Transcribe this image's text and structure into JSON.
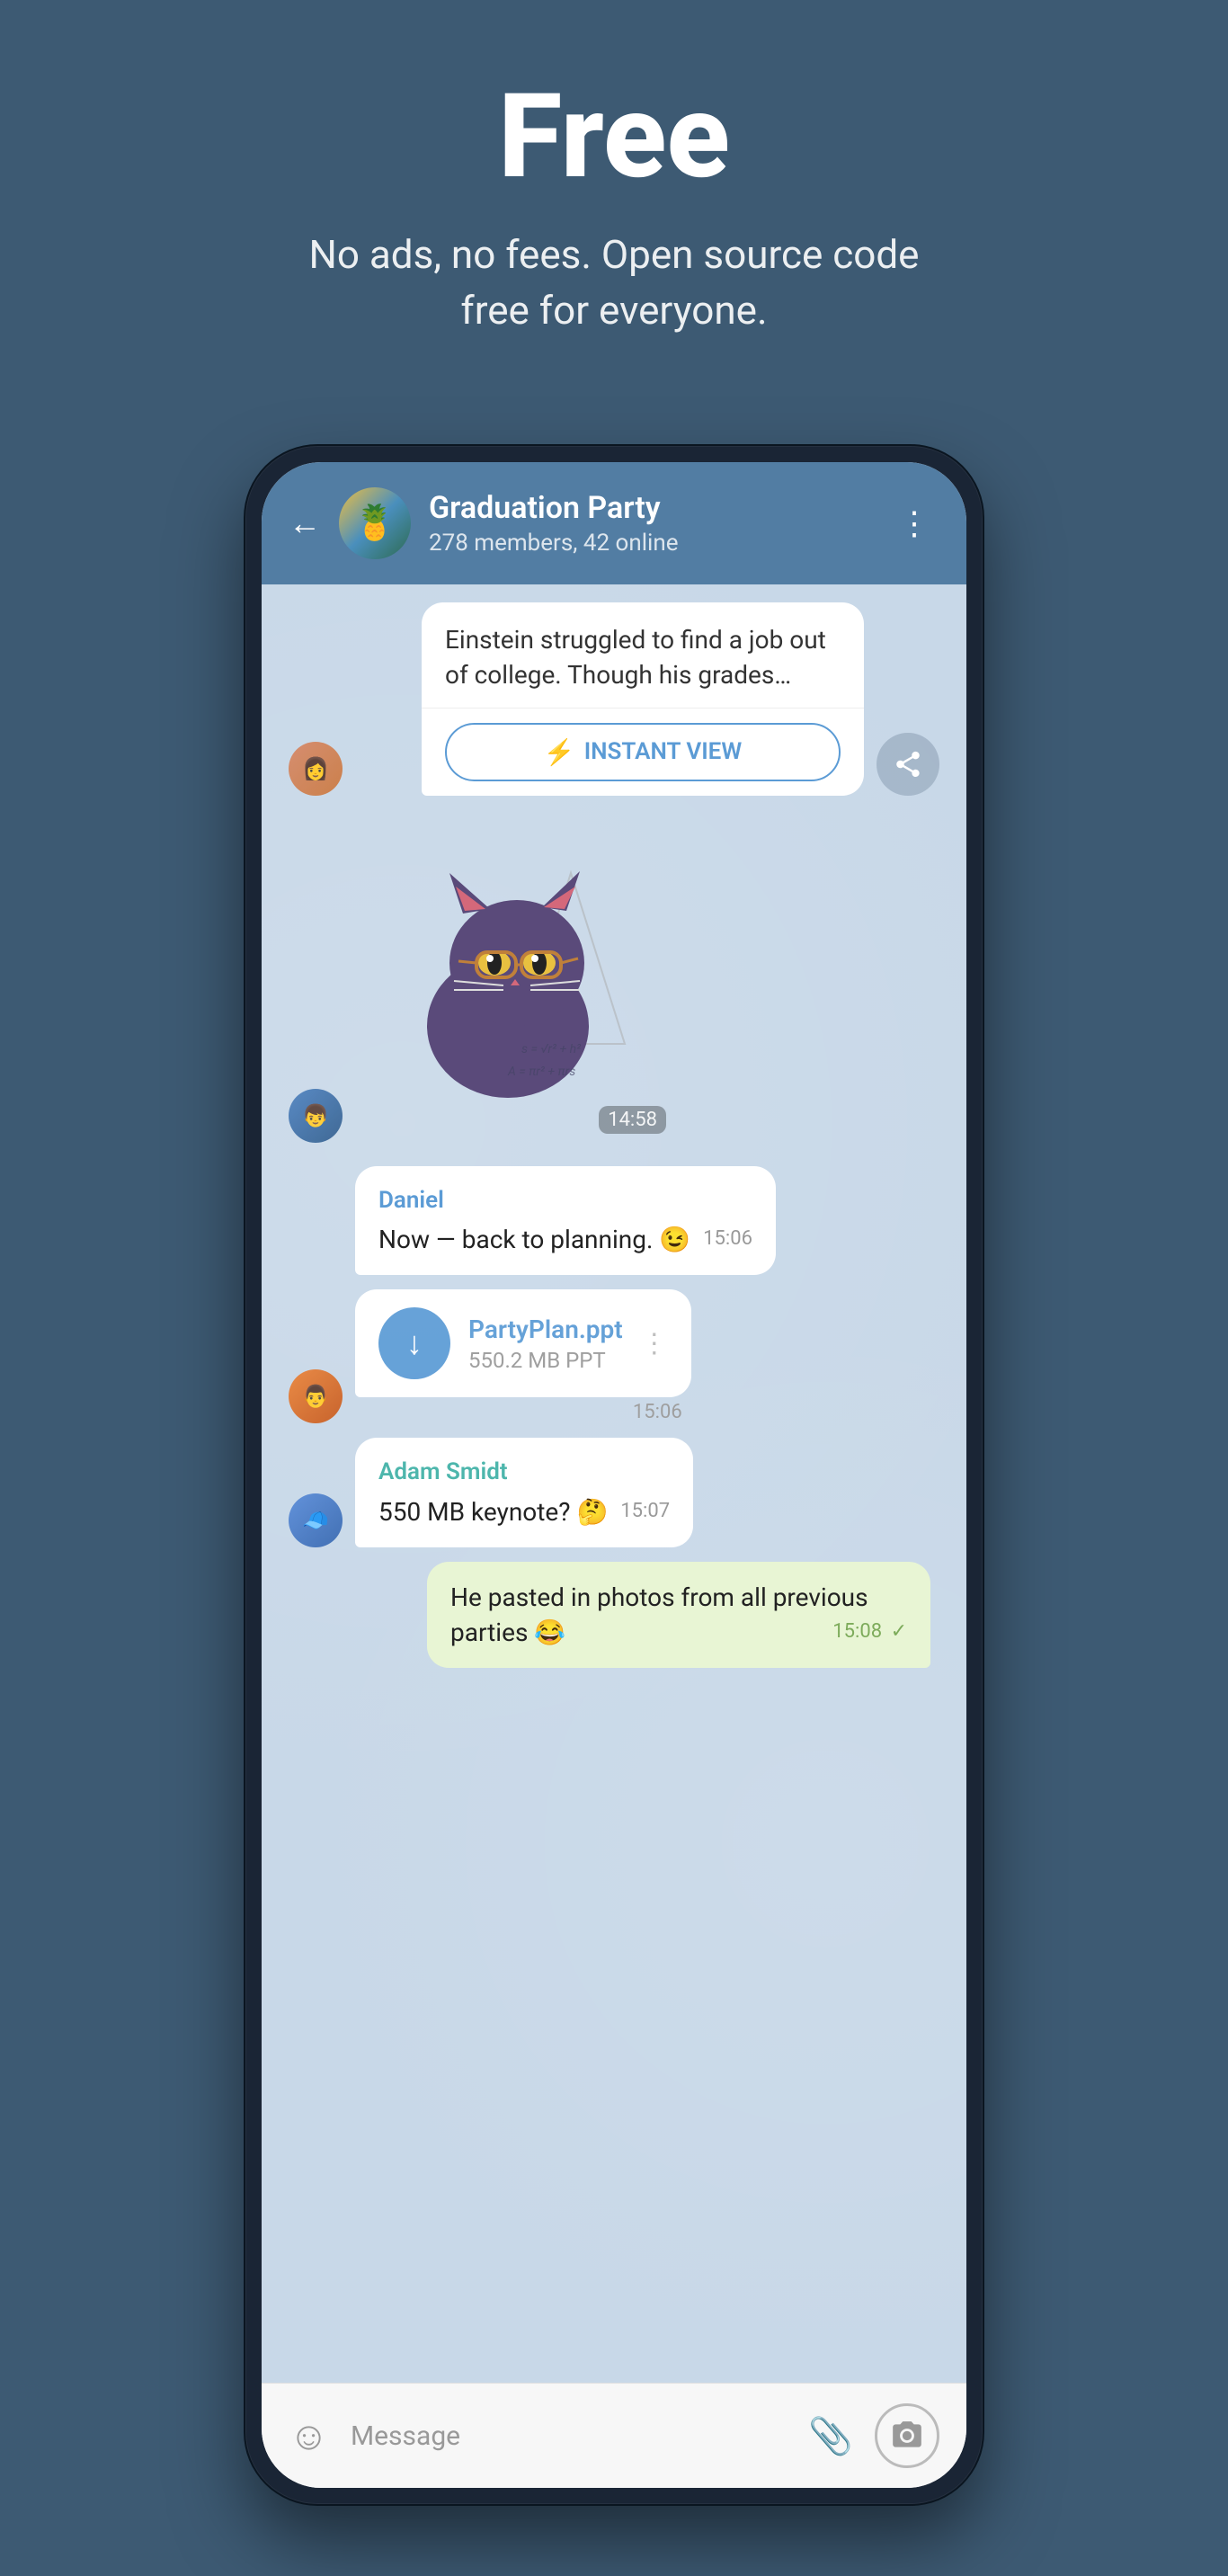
{
  "hero": {
    "title": "Free",
    "subtitle": "No ads, no fees. Open source code free for everyone."
  },
  "chat": {
    "header": {
      "group_name": "Graduation Party",
      "status": "278 members, 42 online",
      "back_label": "←",
      "menu_label": "⋮"
    },
    "messages": [
      {
        "id": "iv-msg",
        "type": "instant_view",
        "text": "Einstein struggled to find a job out of college. Though his grades…",
        "button_label": "INSTANT VIEW",
        "button_icon": "⚡"
      },
      {
        "id": "sticker-msg",
        "type": "sticker",
        "time": "14:58",
        "emoji": "🐱"
      },
      {
        "id": "daniel-msg",
        "type": "incoming",
        "sender": "Daniel",
        "sender_color": "daniel",
        "text": "Now — back to planning. 😉",
        "time": "15:06"
      },
      {
        "id": "file-msg",
        "type": "file",
        "filename": "PartyPlan.ppt",
        "filesize": "550.2 MB PPT",
        "time": "15:06"
      },
      {
        "id": "adam-msg",
        "type": "incoming",
        "sender": "Adam Smidt",
        "sender_color": "adam",
        "text": "550 MB keynote? 🤔",
        "time": "15:07"
      },
      {
        "id": "self-msg",
        "type": "outgoing",
        "text": "He pasted in photos from all previous parties 😂",
        "time": "15:08",
        "read": true
      }
    ],
    "input": {
      "placeholder": "Message"
    }
  }
}
